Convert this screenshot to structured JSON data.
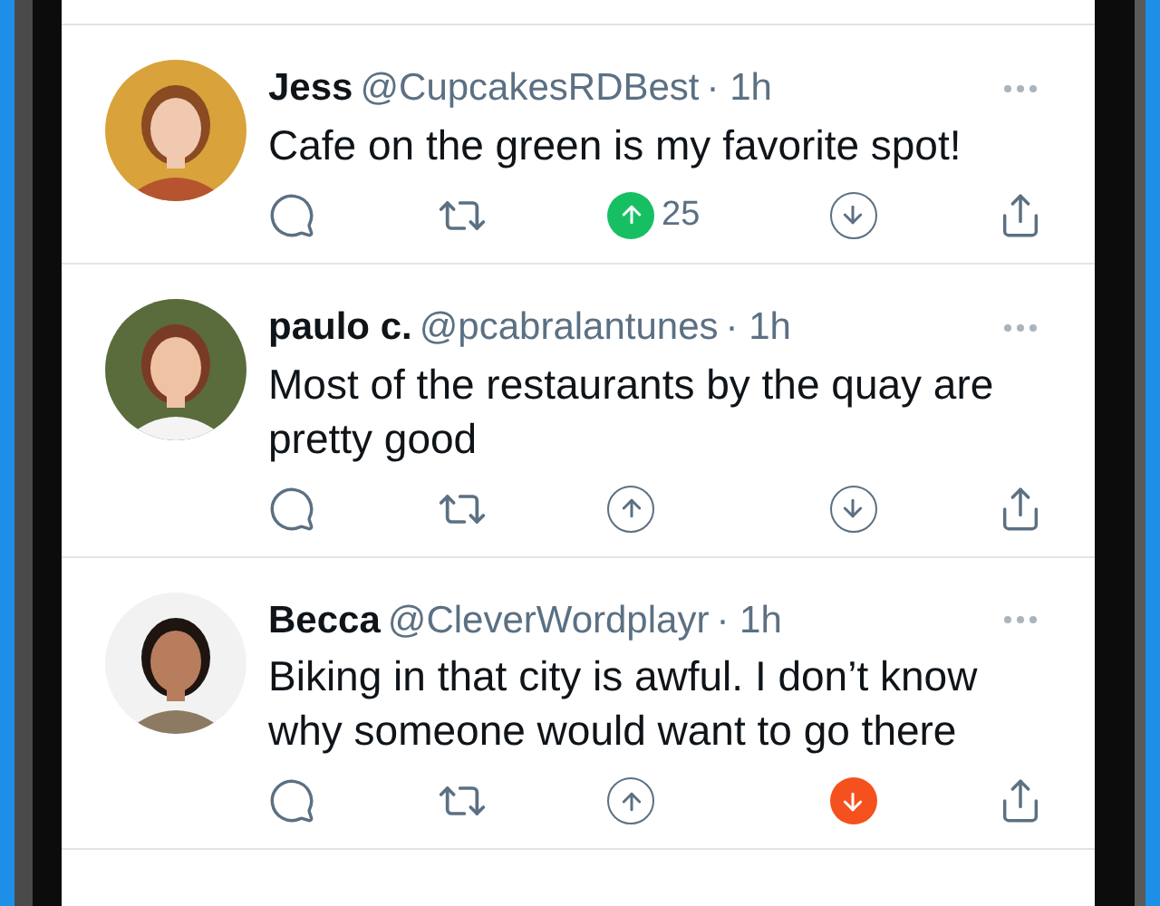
{
  "tweets": [
    {
      "name": "Jess",
      "handle": "@CupcakesRDBest",
      "time": "· 1h",
      "text": "Cafe on the green is my favorite spot!",
      "upvoted": true,
      "upvotes": "25",
      "downvoted": false
    },
    {
      "name": "paulo c.",
      "handle": "@pcabralantunes",
      "time": "· 1h",
      "text": "Most of the restaurants by the quay are pretty good",
      "upvoted": false,
      "downvoted": false
    },
    {
      "name": "Becca",
      "handle": "@CleverWordplayr",
      "time": "· 1h",
      "text": "Biking in that city is awful. I don’t know why someone would want to go there",
      "upvoted": false,
      "downvoted": true
    }
  ]
}
